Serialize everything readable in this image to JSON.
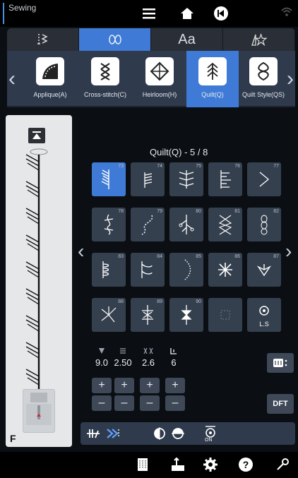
{
  "status_bar": {
    "mode": "Sewing",
    "icons": [
      "menu-icon",
      "home-icon",
      "back-icon",
      "wifi-icon"
    ]
  },
  "category_tabs": [
    {
      "name": "utility-stitch",
      "icon": "utility-stitch-icon",
      "active": false
    },
    {
      "name": "decorative-stitch",
      "icon": "decorative-stitch-icon",
      "active": true
    },
    {
      "name": "letters",
      "label": "Aa",
      "active": false
    },
    {
      "name": "my-designs",
      "icon": "stitch-star-icon",
      "active": false
    }
  ],
  "stitch_categories": [
    {
      "label": "Applique(A)",
      "active": false
    },
    {
      "label": "Cross-stitch(C)",
      "active": false
    },
    {
      "label": "Heirloom(H)",
      "active": false
    },
    {
      "label": "Quilt(Q)",
      "active": true
    },
    {
      "label": "Quilt Style(QS)",
      "active": false
    }
  ],
  "grid": {
    "title": "Quilt(Q) - 5 / 8",
    "stitch_numbers": [
      "73",
      "74",
      "75",
      "76",
      "77",
      "78",
      "79",
      "80",
      "81",
      "82",
      "83",
      "84",
      "85",
      "86",
      "87",
      "88",
      "89",
      "90",
      "",
      ""
    ],
    "selected": "73",
    "ls_label": "L.S"
  },
  "params": [
    {
      "name": "width",
      "value": "9.0"
    },
    {
      "name": "length",
      "value": "2.50"
    },
    {
      "name": "density",
      "value": "2.6"
    },
    {
      "name": "tension",
      "value": "6"
    }
  ],
  "buttons": {
    "plus": "+",
    "minus": "–",
    "dft": "DFT"
  },
  "preview": {
    "foot_letter": "F"
  },
  "tool_row": {
    "on_label": "ON"
  },
  "colors": {
    "accent": "#3f7bd6",
    "panel": "#2f3a4c",
    "cell": "#35404f"
  }
}
